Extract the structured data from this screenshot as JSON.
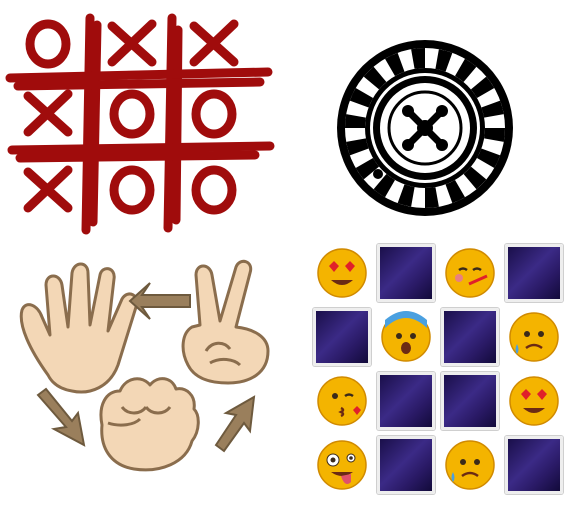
{
  "games": [
    {
      "id": "tic-tac-toe",
      "icon": "tic-tac-toe-icon",
      "color": "#a00c0c",
      "board": [
        [
          "O",
          "X",
          "X"
        ],
        [
          "X",
          "O",
          "O"
        ],
        [
          "X",
          "O",
          "O"
        ]
      ]
    },
    {
      "id": "roulette",
      "icon": "roulette-wheel-icon",
      "color": "#000000"
    },
    {
      "id": "rock-paper-scissors",
      "icon": "rock-paper-scissors-icon",
      "skin": "#f3d7b6",
      "arrow": "#9a7f5c"
    },
    {
      "id": "memory-match",
      "icon": "memory-cards-icon",
      "back_color": "#2a1a66",
      "grid": [
        [
          "heart-eyes",
          "back",
          "sick-thermometer",
          "back"
        ],
        [
          "back",
          "fearful",
          "back",
          "sad-sweat"
        ],
        [
          "kiss-wink",
          "back",
          "back",
          "heart-eyes"
        ],
        [
          "zany",
          "back",
          "sad-sweat",
          "back"
        ]
      ]
    }
  ]
}
